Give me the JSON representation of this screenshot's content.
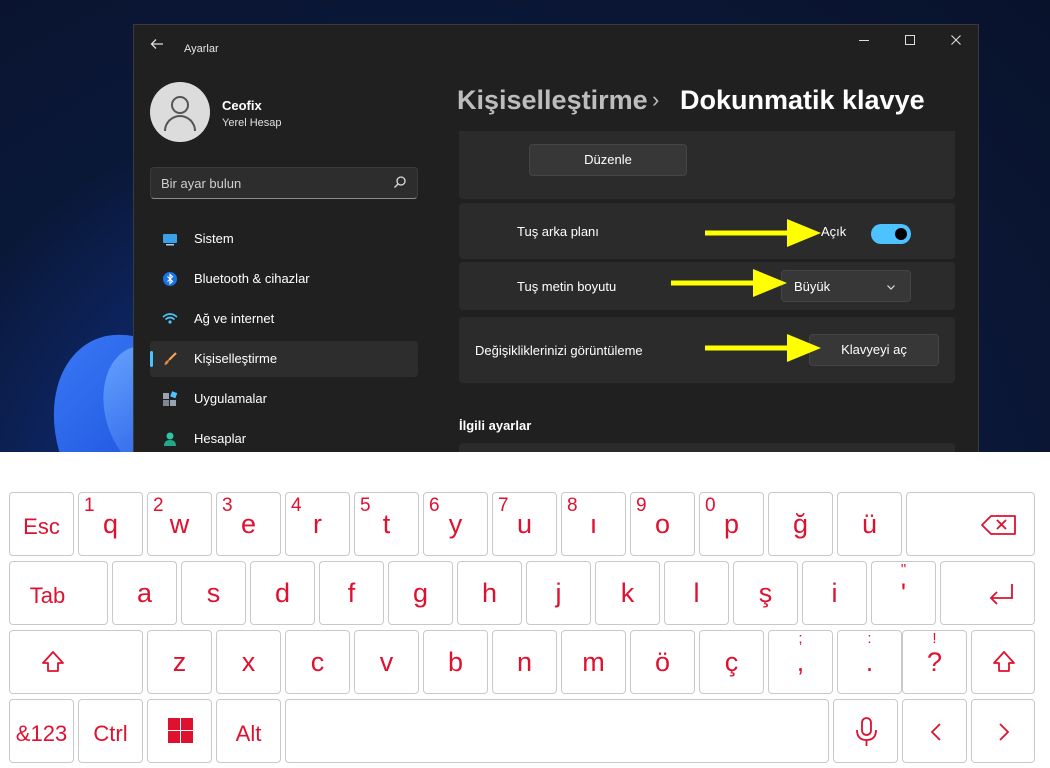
{
  "window": {
    "app_title": "Ayarlar",
    "user": {
      "name": "Ceofix",
      "account_type": "Yerel Hesap"
    },
    "search": {
      "placeholder": "Bir ayar bulun"
    },
    "nav": [
      {
        "label": "Sistem",
        "icon": "monitor-icon",
        "active": false
      },
      {
        "label": "Bluetooth & cihazlar",
        "icon": "bluetooth-icon",
        "active": false
      },
      {
        "label": "Ağ ve internet",
        "icon": "wifi-icon",
        "active": false
      },
      {
        "label": "Kişiselleştirme",
        "icon": "brush-icon",
        "active": true
      },
      {
        "label": "Uygulamalar",
        "icon": "apps-icon",
        "active": false
      },
      {
        "label": "Hesaplar",
        "icon": "person-icon",
        "active": false
      }
    ],
    "breadcrumb": {
      "parent": "Kişiselleştirme",
      "separator": "›",
      "current": "Dokunmatik klavye"
    },
    "content": {
      "edit_button": "Düzenle",
      "key_background": {
        "label": "Tuş arka planı",
        "state_text": "Açık",
        "on": true
      },
      "key_text_size": {
        "label": "Tuş metin boyutu",
        "value": "Büyük"
      },
      "view_changes": {
        "label": "Değişikliklerinizi görüntüleme",
        "button": "Klavyeyi aç"
      },
      "related_title": "İlgili ayarlar"
    },
    "colors": {
      "accent": "#4cc2ff",
      "arrow": "#ffff00",
      "keyboard_text": "#e0102f"
    }
  },
  "keyboard": {
    "row1": [
      {
        "main": "Esc"
      },
      {
        "main": "q",
        "hint": "1"
      },
      {
        "main": "w",
        "hint": "2"
      },
      {
        "main": "e",
        "hint": "3"
      },
      {
        "main": "r",
        "hint": "4"
      },
      {
        "main": "t",
        "hint": "5"
      },
      {
        "main": "y",
        "hint": "6"
      },
      {
        "main": "u",
        "hint": "7"
      },
      {
        "main": "ı",
        "hint": "8"
      },
      {
        "main": "o",
        "hint": "9"
      },
      {
        "main": "p",
        "hint": "0"
      },
      {
        "main": "ğ"
      },
      {
        "main": "ü"
      }
    ],
    "row2": [
      {
        "main": "Tab"
      },
      {
        "main": "a"
      },
      {
        "main": "s"
      },
      {
        "main": "d"
      },
      {
        "main": "f"
      },
      {
        "main": "g"
      },
      {
        "main": "h"
      },
      {
        "main": "j"
      },
      {
        "main": "k"
      },
      {
        "main": "l"
      },
      {
        "main": "ş"
      },
      {
        "main": "i"
      },
      {
        "main": "'",
        "hint": "\""
      }
    ],
    "row3": [
      {
        "main": "z"
      },
      {
        "main": "x"
      },
      {
        "main": "c"
      },
      {
        "main": "v"
      },
      {
        "main": "b"
      },
      {
        "main": "n"
      },
      {
        "main": "m"
      },
      {
        "main": "ö"
      },
      {
        "main": "ç"
      },
      {
        "main": ",",
        "hint": ";"
      },
      {
        "main": ".",
        "hint": ":"
      },
      {
        "main": "?",
        "hint": "!"
      }
    ],
    "row4": [
      {
        "main": "&123"
      },
      {
        "main": "Ctrl"
      },
      {
        "main": "Alt"
      }
    ]
  }
}
